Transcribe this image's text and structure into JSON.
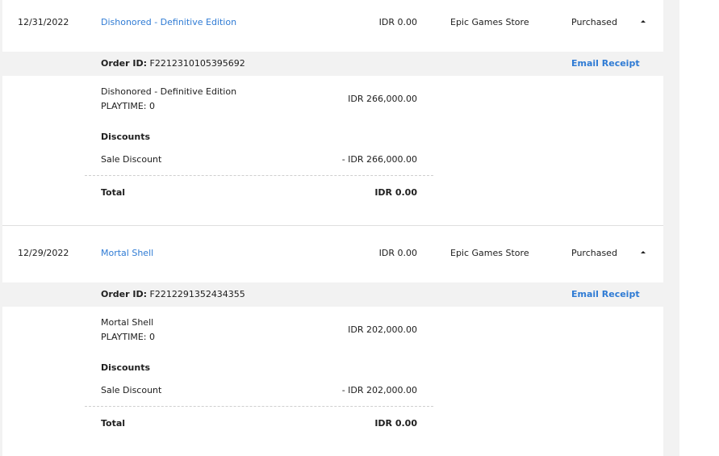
{
  "transactions": [
    {
      "date": "12/31/2022",
      "title": "Dishonored - Definitive Edition",
      "price": "IDR 0.00",
      "store": "Epic Games Store",
      "status": "Purchased",
      "order_label": "Order ID:",
      "order_id": "F2212310105395692",
      "email_receipt": "Email Receipt",
      "item_name": "Dishonored - Definitive Edition",
      "playtime": "PLAYTIME: 0",
      "item_price": "IDR 266,000.00",
      "discounts_heading": "Discounts",
      "discount_name": "Sale Discount",
      "discount_amount": "- IDR 266,000.00",
      "total_label": "Total",
      "total_amount": "IDR 0.00"
    },
    {
      "date": "12/29/2022",
      "title": "Mortal Shell",
      "price": "IDR 0.00",
      "store": "Epic Games Store",
      "status": "Purchased",
      "order_label": "Order ID:",
      "order_id": "F2212291352434355",
      "email_receipt": "Email Receipt",
      "item_name": "Mortal Shell",
      "playtime": "PLAYTIME: 0",
      "item_price": "IDR 202,000.00",
      "discounts_heading": "Discounts",
      "discount_name": "Sale Discount",
      "discount_amount": "- IDR 202,000.00",
      "total_label": "Total",
      "total_amount": "IDR 0.00"
    }
  ],
  "icons": {
    "collapse": "caret-up-icon"
  },
  "colors": {
    "link": "#2f7bd4",
    "bar": "#f2f2f2",
    "background": "#ffffff"
  }
}
